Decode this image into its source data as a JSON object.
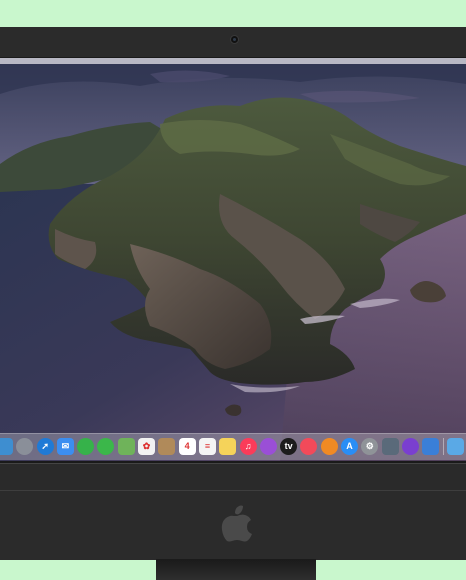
{
  "device": "iMac",
  "colors": {
    "background": "#c9f7cd",
    "bezel": "#2b2b2b"
  },
  "icons": {
    "camera": "camera-icon",
    "brand": "apple-logo-icon"
  },
  "wallpaper": {
    "scene": "macOS Catalina island"
  },
  "dock": {
    "items": [
      {
        "name": "finder-icon",
        "color": "#3e8ed0",
        "glyph": ""
      },
      {
        "name": "launchpad-icon",
        "color": "#8a8f99",
        "glyph": ""
      },
      {
        "name": "safari-icon",
        "color": "#1f7ad6",
        "glyph": "➚"
      },
      {
        "name": "mail-icon",
        "color": "#3c8ef0",
        "glyph": "✉"
      },
      {
        "name": "facetime-icon",
        "color": "#36b24a",
        "glyph": ""
      },
      {
        "name": "messages-icon",
        "color": "#3bb74a",
        "glyph": ""
      },
      {
        "name": "maps-icon",
        "color": "#6fb35a",
        "glyph": ""
      },
      {
        "name": "photos-icon",
        "color": "#f2f2f2",
        "glyph": "✿"
      },
      {
        "name": "contacts-icon",
        "color": "#b08a5a",
        "glyph": ""
      },
      {
        "name": "calendar-icon",
        "color": "#ffffff",
        "glyph": "4"
      },
      {
        "name": "reminders-icon",
        "color": "#f4f4f4",
        "glyph": "≡"
      },
      {
        "name": "notes-icon",
        "color": "#f5d35a",
        "glyph": ""
      },
      {
        "name": "music-icon",
        "color": "#fa3c5a",
        "glyph": "♫"
      },
      {
        "name": "podcasts-icon",
        "color": "#9a4fd6",
        "glyph": ""
      },
      {
        "name": "tv-icon",
        "color": "#1c1c1c",
        "glyph": "tv"
      },
      {
        "name": "news-icon",
        "color": "#f24a5a",
        "glyph": ""
      },
      {
        "name": "books-icon",
        "color": "#f08a24",
        "glyph": ""
      },
      {
        "name": "app-store-icon",
        "color": "#2a8ef5",
        "glyph": "A"
      },
      {
        "name": "system-preferences-icon",
        "color": "#8f9398",
        "glyph": "⚙"
      },
      {
        "name": "preview-icon",
        "color": "#5a6a7a",
        "glyph": ""
      },
      {
        "name": "screen-time-icon",
        "color": "#7a3fd0",
        "glyph": ""
      },
      {
        "name": "xcode-icon",
        "color": "#3a7fd8",
        "glyph": ""
      },
      {
        "name": "downloads-folder-icon",
        "color": "#5aa9e6",
        "glyph": ""
      },
      {
        "name": "trash-icon",
        "color": "#9aa0a8",
        "glyph": ""
      }
    ]
  }
}
